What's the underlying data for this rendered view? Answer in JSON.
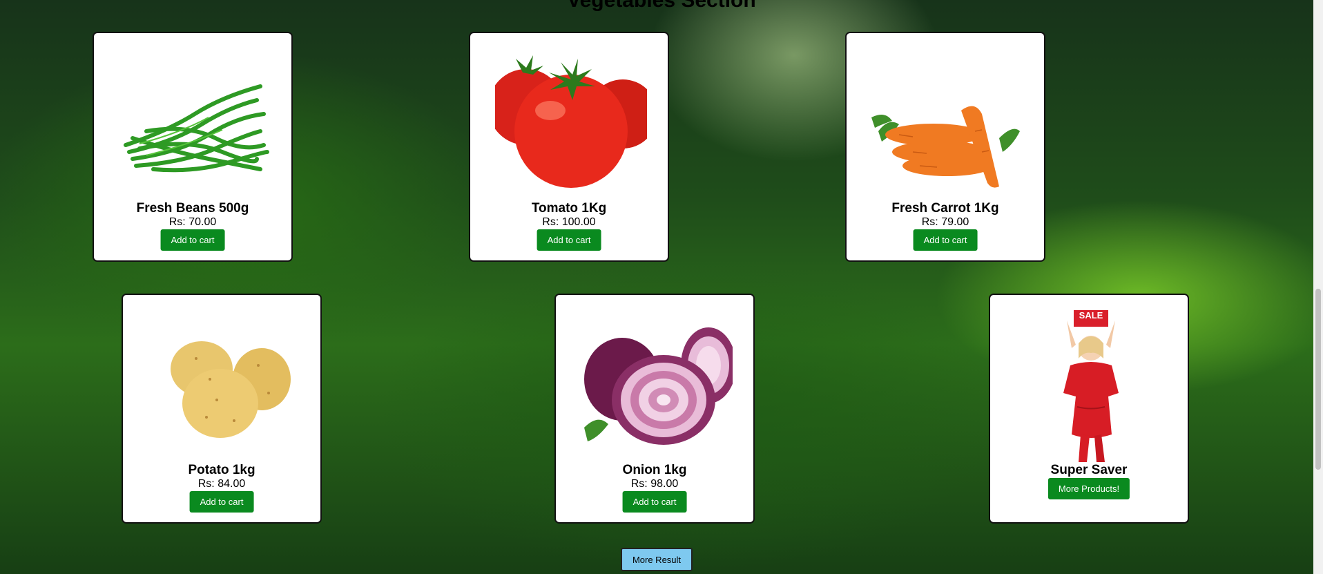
{
  "section": {
    "title": "Vegetables Section"
  },
  "products": [
    {
      "name": "Fresh Beans 500g",
      "price": "Rs: 70.00",
      "button": "Add to cart",
      "image": "green-beans"
    },
    {
      "name": "Tomato 1Kg",
      "price": "Rs: 100.00",
      "button": "Add to cart",
      "image": "tomatoes"
    },
    {
      "name": "Fresh Carrot 1Kg",
      "price": "Rs: 79.00",
      "button": "Add to cart",
      "image": "carrots"
    },
    {
      "name": "Potato 1kg",
      "price": "Rs: 84.00",
      "button": "Add to cart",
      "image": "potatoes"
    },
    {
      "name": "Onion 1kg",
      "price": "Rs: 98.00",
      "button": "Add to cart",
      "image": "red-onions"
    },
    {
      "name": "Super Saver",
      "button": "More Products!",
      "image": "sale-woman",
      "badge": "SALE"
    }
  ],
  "footer": {
    "more_result": "More Result"
  },
  "colors": {
    "button": "#0a8a1f",
    "more_result": "#7ec9ef",
    "card_border": "#111111"
  }
}
